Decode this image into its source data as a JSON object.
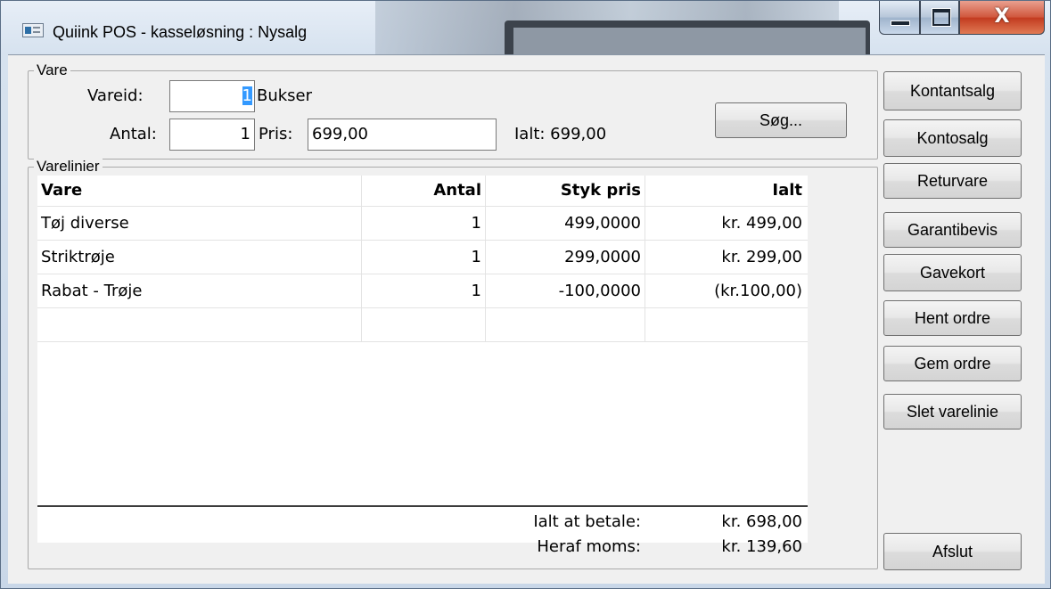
{
  "window": {
    "title": "Quiink POS - kasseløsning : Nysalg",
    "close_glyph": "X",
    "icons": [
      "app-icon",
      "minimize-icon",
      "maximize-icon",
      "close-icon"
    ]
  },
  "vare": {
    "group_label": "Vare",
    "vareid_label": "Vareid:",
    "vareid_value": "1",
    "product_name": "Bukser",
    "antal_label": "Antal:",
    "antal_value": "1",
    "pris_label": "Pris:",
    "pris_value": "699,00",
    "ialt_text": "Ialt: 699,00",
    "search_button": "Søg..."
  },
  "varelinier": {
    "group_label": "Varelinier",
    "columns": [
      "Vare",
      "Antal",
      "Styk pris",
      "Ialt"
    ],
    "rows": [
      {
        "vare": "Tøj diverse",
        "antal": "1",
        "styk_pris": "499,0000",
        "ialt": "kr. 499,00"
      },
      {
        "vare": "Striktrøje",
        "antal": "1",
        "styk_pris": "299,0000",
        "ialt": "kr. 299,00"
      },
      {
        "vare": "Rabat - Trøje",
        "antal": "1",
        "styk_pris": "-100,0000",
        "ialt": "(kr.100,00)"
      }
    ],
    "total_label": "Ialt at betale:",
    "total_value": "kr. 698,00",
    "moms_label": "Heraf moms:",
    "moms_value": "kr. 139,60"
  },
  "side_buttons": [
    "Kontantsalg",
    "Kontosalg",
    "Returvare",
    "Garantibevis",
    "Gavekort",
    "Hent ordre",
    "Gem ordre",
    "Slet varelinie"
  ],
  "exit_button": "Afslut",
  "colors": {
    "selection": "#3399ff",
    "close_button": "#c8452a",
    "dialog_background": "#f0f0f0"
  }
}
